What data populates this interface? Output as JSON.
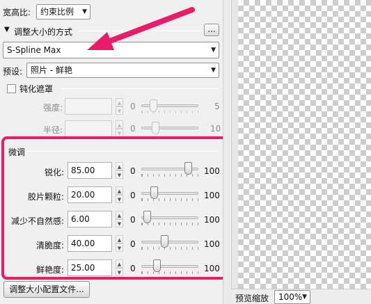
{
  "header": {
    "ratio_label": "宽高比:",
    "ratio_value": "约束比例"
  },
  "method": {
    "section_title": "调整大小的方式",
    "more_button": "...",
    "method_value": "S-Spline Max"
  },
  "preset": {
    "label": "预设:",
    "value": "照片 - 鲜艳"
  },
  "sharpen_mask": {
    "checkbox_label": "钝化遮罩",
    "checked": false,
    "rows": [
      {
        "label": "强度:",
        "value": "",
        "min": "0",
        "max": "5",
        "level": 0.5
      },
      {
        "label": "半径:",
        "value": "",
        "min": "0",
        "max": "10",
        "level": 0.5
      }
    ]
  },
  "fine_tune": {
    "title": "微调",
    "rows": [
      {
        "label": "锐化:",
        "value": "85.00",
        "min": "0",
        "max": "100",
        "level": 0.85
      },
      {
        "label": "胶片颗粒:",
        "value": "20.00",
        "min": "0",
        "max": "100",
        "level": 0.2
      },
      {
        "label": "减少不自然感:",
        "value": "6.00",
        "min": "0",
        "max": "100",
        "level": 0.06
      },
      {
        "label": "清脆度:",
        "value": "40.00",
        "min": "0",
        "max": "100",
        "level": 0.4
      },
      {
        "label": "鲜艳度:",
        "value": "25.00",
        "min": "0",
        "max": "100",
        "level": 0.25
      }
    ]
  },
  "profile_button": "调整大小配置文件...",
  "preview": {
    "zoom_label": "预览缩放",
    "zoom_value": "100%"
  },
  "colors": {
    "highlight": "#ec1a6b",
    "annotation_arrow": "#ec1a6b"
  }
}
